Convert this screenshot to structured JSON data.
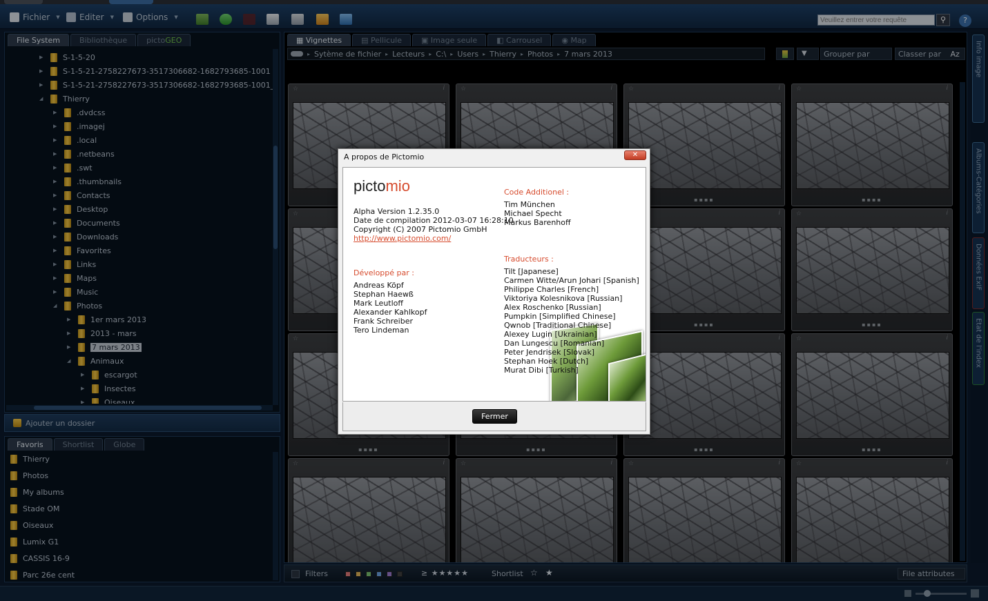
{
  "menubar": {
    "fichier": "Fichier",
    "editer": "Editer",
    "options": "Options",
    "search_placeholder": "Veuillez entrer votre requête"
  },
  "left_tabs": [
    "File System",
    "Bibliothèque",
    "picto"
  ],
  "left_tab_geo": "GEO",
  "tree": [
    {
      "label": "S-1-5-20",
      "depth": 0,
      "open": false
    },
    {
      "label": "S-1-5-21-2758227673-3517306682-1682793685-1001",
      "depth": 0,
      "open": false
    },
    {
      "label": "S-1-5-21-2758227673-3517306682-1682793685-1001_Classes",
      "depth": 0,
      "open": false
    },
    {
      "label": "Thierry",
      "depth": 0,
      "open": true
    },
    {
      "label": ".dvdcss",
      "depth": 1,
      "open": false
    },
    {
      "label": ".imagej",
      "depth": 1,
      "open": false
    },
    {
      "label": ".local",
      "depth": 1,
      "open": false
    },
    {
      "label": ".netbeans",
      "depth": 1,
      "open": false
    },
    {
      "label": ".swt",
      "depth": 1,
      "open": false
    },
    {
      "label": ".thumbnails",
      "depth": 1,
      "open": false
    },
    {
      "label": "Contacts",
      "depth": 1,
      "open": false
    },
    {
      "label": "Desktop",
      "depth": 1,
      "open": false
    },
    {
      "label": "Documents",
      "depth": 1,
      "open": false
    },
    {
      "label": "Downloads",
      "depth": 1,
      "open": false
    },
    {
      "label": "Favorites",
      "depth": 1,
      "open": false
    },
    {
      "label": "Links",
      "depth": 1,
      "open": false
    },
    {
      "label": "Maps",
      "depth": 1,
      "open": false
    },
    {
      "label": "Music",
      "depth": 1,
      "open": false
    },
    {
      "label": "Photos",
      "depth": 1,
      "open": true
    },
    {
      "label": "1er mars 2013",
      "depth": 2,
      "open": false
    },
    {
      "label": "2013 - mars",
      "depth": 2,
      "open": false
    },
    {
      "label": "7 mars 2013",
      "depth": 2,
      "open": false,
      "selected": true
    },
    {
      "label": "Animaux",
      "depth": 2,
      "open": true
    },
    {
      "label": "escargot",
      "depth": 3,
      "open": false
    },
    {
      "label": "Insectes",
      "depth": 3,
      "open": false
    },
    {
      "label": "Oiseaux",
      "depth": 3,
      "open": false
    }
  ],
  "add_folder": "Ajouter un dossier",
  "fav_tabs": [
    "Favoris",
    "Shortlist",
    "Globe"
  ],
  "favorites": [
    "Thierry",
    "Photos",
    "My albums",
    "Stade OM",
    "Oiseaux",
    "Lumix G1",
    "CASSIS 16-9",
    "Parc 26e cent"
  ],
  "view_tabs": [
    "Vignettes",
    "Pellicule",
    "Image seule",
    "Carrousel",
    "Map"
  ],
  "breadcrumb": [
    "Sytème de fichier",
    "Lecteurs",
    "C:\\",
    "Users",
    "Thierry",
    "Photos",
    "7 mars 2013"
  ],
  "group_by": "Grouper par",
  "sort_by": "Classer par",
  "sort_code": "Az",
  "side_tabs": [
    "Info image",
    "Albums-Catégories",
    "Données ExIF",
    "Etat de l'index"
  ],
  "thumb_star": "☆",
  "thumb_info": "i",
  "thumb_dots": "▪▪▪▪",
  "bottombar": {
    "filters": "Filters",
    "rating_prefix": "≥ ★★★★★",
    "shortlist": "Shortlist",
    "file_attributes": "File attributes"
  },
  "colors": {
    "accent_red": "#d64b2d",
    "panel_border": "#1d3856",
    "swatches": [
      "#e07a7a",
      "#e0b45a",
      "#7ac070",
      "#6aa0e0",
      "#9a7ad0",
      "#404040"
    ]
  },
  "dialog": {
    "title": "A propos de Pictomio",
    "close": "✕",
    "logo_a": "picto",
    "logo_b": "mio",
    "version": "Alpha Version 1.2.35.0",
    "build": "Date de compilation 2012-03-07 16:28:10",
    "copyright": "Copyright (C) 2007 Pictomio GmbH",
    "url": "http://www.pictomio.com/",
    "dev_heading": "Développé par :",
    "developers": [
      "Andreas Köpf",
      "Stephan Haewß",
      "Mark Leutloff",
      "Alexander Kahlkopf",
      "Frank Schreiber",
      "Tero Lindeman"
    ],
    "code_heading": "Code Additionel :",
    "code_contrib": [
      "Tim München",
      "Michael Specht",
      "Markus Barenhoff"
    ],
    "trans_heading": "Traducteurs :",
    "translators": [
      "Tilt [Japanese]",
      "Carmen Witte/Arun Johari [Spanish]",
      "Philippe Charles [French]",
      "Viktoriya Kolesnikova [Russian]",
      "Alex Roschenko [Russian]",
      "Pumpkin [Simplified Chinese]",
      "Qwnob [Traditional Chinese]",
      "Alexey Lugin [Ukrainian]",
      "Dan Lungescu [Romanian]",
      "Peter Jendrisek [Slovak]",
      "Stephan Hoek [Dutch]",
      "Murat Dibi [Turkish]"
    ],
    "button": "Fermer"
  }
}
